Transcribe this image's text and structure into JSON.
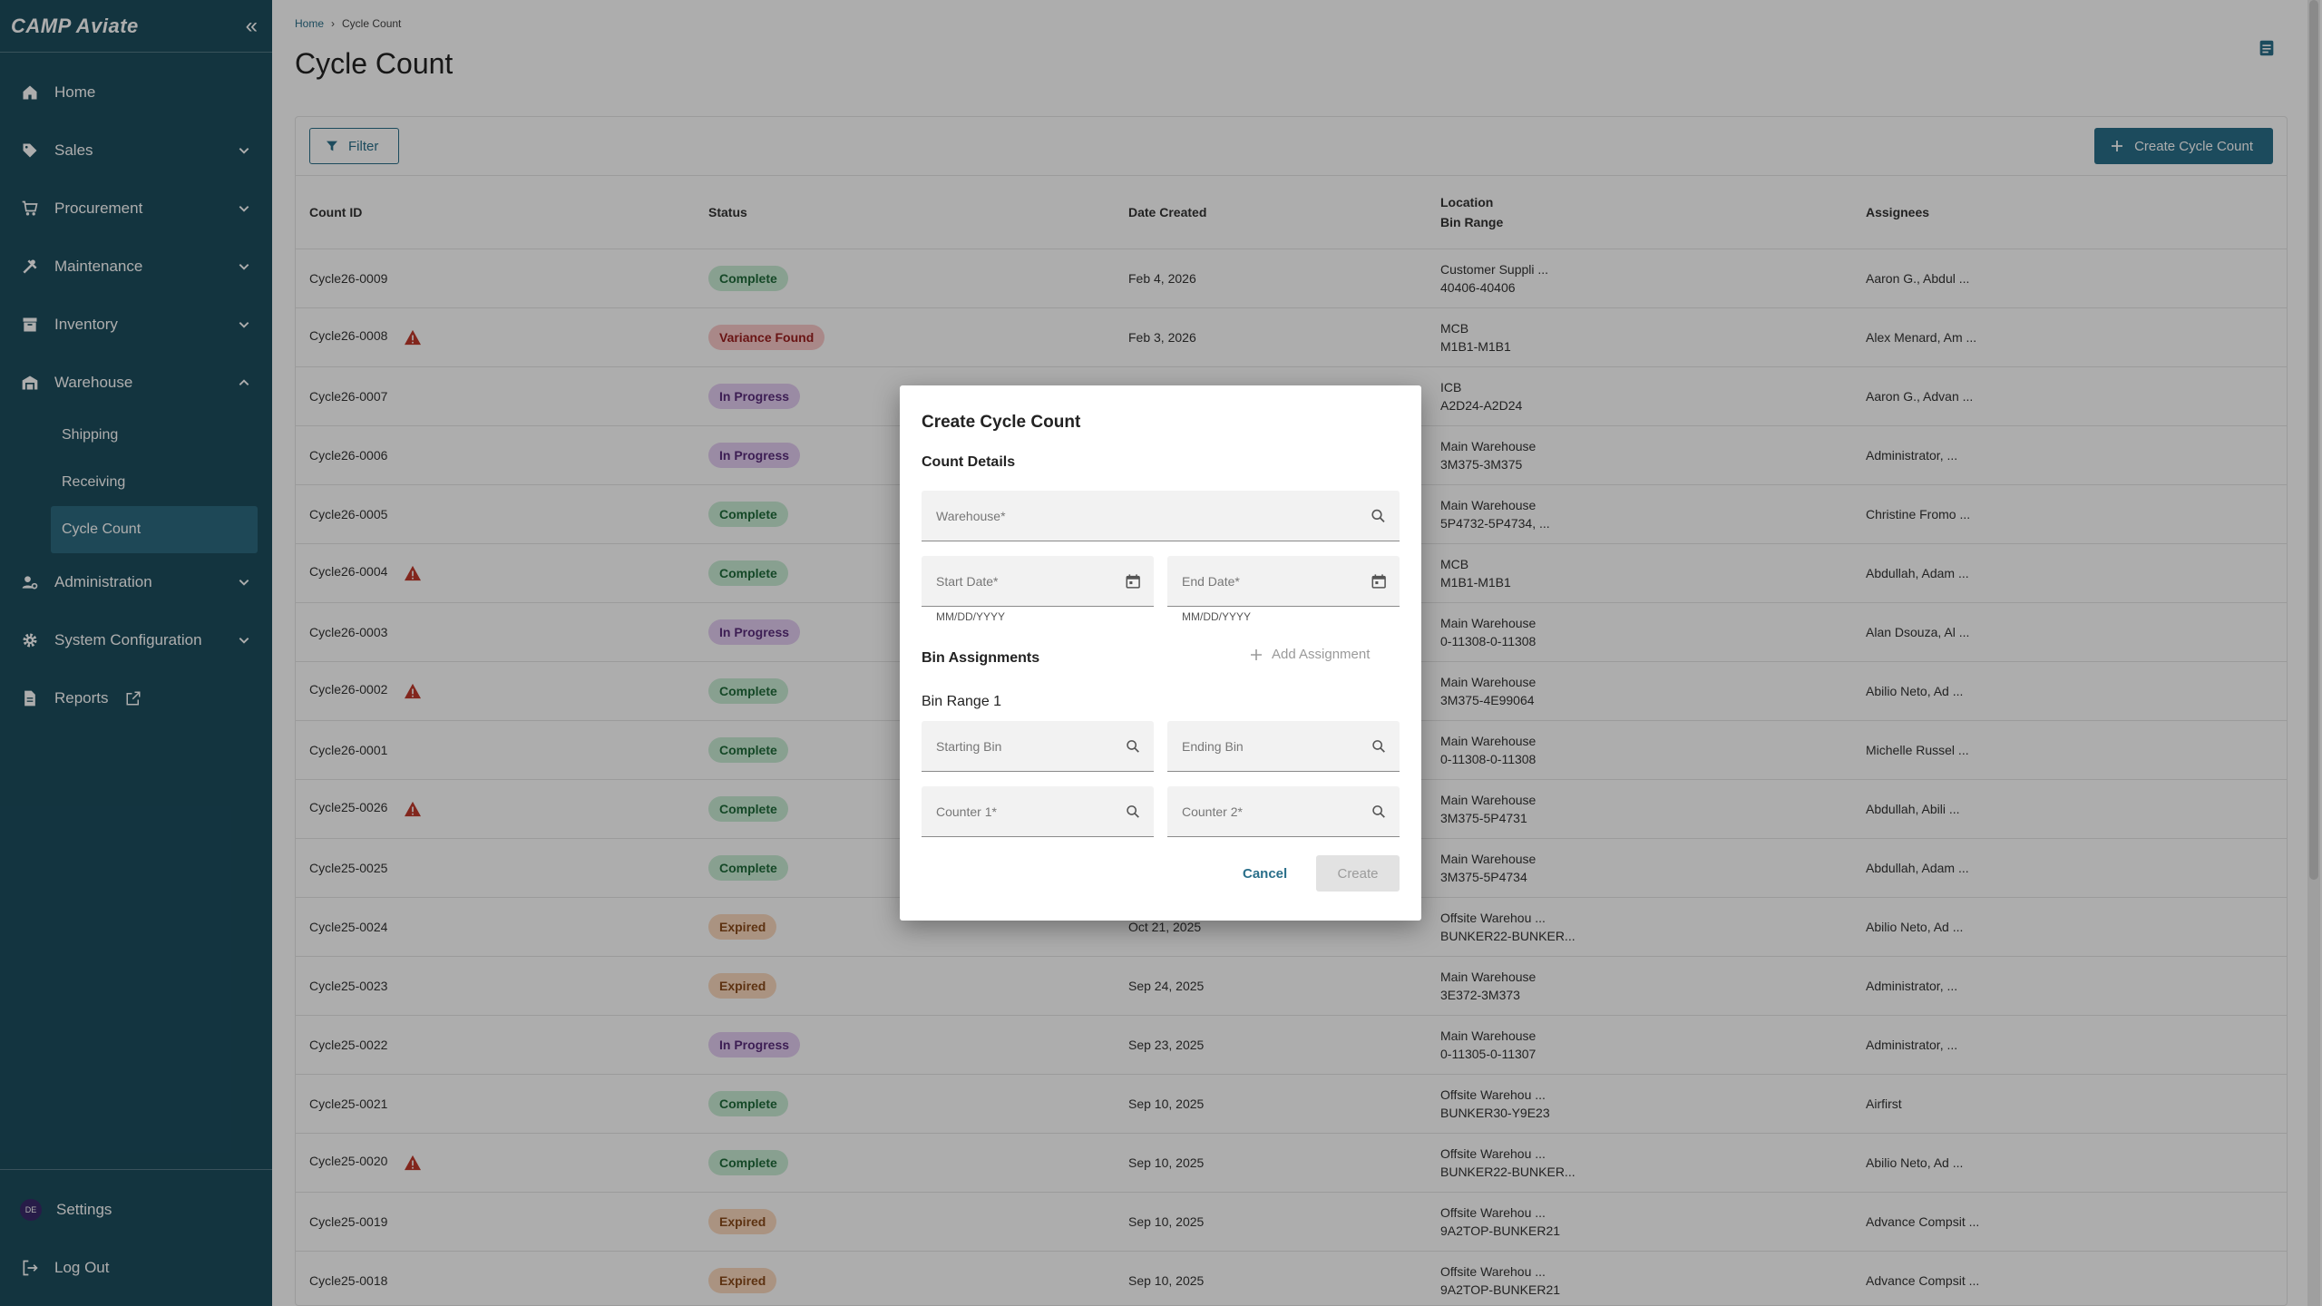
{
  "app": {
    "logo": "CAMP Aviate"
  },
  "sidebar": {
    "items": [
      {
        "label": "Home"
      },
      {
        "label": "Sales"
      },
      {
        "label": "Procurement"
      },
      {
        "label": "Maintenance"
      },
      {
        "label": "Inventory"
      },
      {
        "label": "Warehouse"
      },
      {
        "label": "Administration"
      },
      {
        "label": "System Configuration"
      },
      {
        "label": "Reports"
      }
    ],
    "warehouse_sub": [
      {
        "label": "Shipping"
      },
      {
        "label": "Receiving"
      },
      {
        "label": "Cycle Count"
      }
    ],
    "bottom": {
      "avatar": "DE",
      "settings": "Settings",
      "logout": "Log Out"
    }
  },
  "breadcrumb": {
    "home": "Home",
    "current": "Cycle Count"
  },
  "page": {
    "title": "Cycle Count"
  },
  "toolbar": {
    "filter": "Filter",
    "create": "Create Cycle Count"
  },
  "table": {
    "headers": {
      "count_id": "Count ID",
      "status": "Status",
      "date_created": "Date Created",
      "location": "Location",
      "bin_range": "Bin Range",
      "assignees": "Assignees"
    },
    "rows": [
      {
        "id": "Cycle26-0009",
        "status": "Complete",
        "date": "Feb 4, 2026",
        "location": "Customer Suppli ...",
        "bins": "40406-40406",
        "assignees": "Aaron G., Abdul ..."
      },
      {
        "id": "Cycle26-0008",
        "warn": true,
        "status": "Variance Found",
        "date": "Feb 3, 2026",
        "location": "MCB",
        "bins": "M1B1-M1B1",
        "assignees": "Alex Menard, Am ..."
      },
      {
        "id": "Cycle26-0007",
        "status": "In Progress",
        "date": "",
        "location": "ICB",
        "bins": "A2D24-A2D24",
        "assignees": "Aaron G., Advan ..."
      },
      {
        "id": "Cycle26-0006",
        "status": "In Progress",
        "date": "",
        "location": "Main Warehouse",
        "bins": "3M375-3M375",
        "assignees": "Administrator, ..."
      },
      {
        "id": "Cycle26-0005",
        "status": "Complete",
        "date": "",
        "location": "Main Warehouse",
        "bins": "5P4732-5P4734, ...",
        "assignees": "Christine Fromo ..."
      },
      {
        "id": "Cycle26-0004",
        "warn": true,
        "status": "Complete",
        "date": "",
        "location": "MCB",
        "bins": "M1B1-M1B1",
        "assignees": "Abdullah, Adam ..."
      },
      {
        "id": "Cycle26-0003",
        "status": "In Progress",
        "date": "",
        "location": "Main Warehouse",
        "bins": "0-11308-0-11308",
        "assignees": "Alan Dsouza, Al ..."
      },
      {
        "id": "Cycle26-0002",
        "warn": true,
        "status": "Complete",
        "date": "",
        "location": "Main Warehouse",
        "bins": "3M375-4E99064",
        "assignees": "Abilio Neto, Ad ..."
      },
      {
        "id": "Cycle26-0001",
        "status": "Complete",
        "date": "",
        "location": "Main Warehouse",
        "bins": "0-11308-0-11308",
        "assignees": "Michelle Russel ..."
      },
      {
        "id": "Cycle25-0026",
        "warn": true,
        "status": "Complete",
        "date": "",
        "location": "Main Warehouse",
        "bins": "3M375-5P4731",
        "assignees": "Abdullah, Abili ..."
      },
      {
        "id": "Cycle25-0025",
        "status": "Complete",
        "date": "",
        "location": "Main Warehouse",
        "bins": "3M375-5P4734",
        "assignees": "Abdullah, Adam ..."
      },
      {
        "id": "Cycle25-0024",
        "status": "Expired",
        "date": "Oct 21, 2025",
        "location": "Offsite Warehou ...",
        "bins": "BUNKER22-BUNKER...",
        "assignees": "Abilio Neto, Ad ..."
      },
      {
        "id": "Cycle25-0023",
        "status": "Expired",
        "date": "Sep 24, 2025",
        "location": "Main Warehouse",
        "bins": "3E372-3M373",
        "assignees": "Administrator, ..."
      },
      {
        "id": "Cycle25-0022",
        "status": "In Progress",
        "date": "Sep 23, 2025",
        "location": "Main Warehouse",
        "bins": "0-11305-0-11307",
        "assignees": "Administrator, ..."
      },
      {
        "id": "Cycle25-0021",
        "status": "Complete",
        "date": "Sep 10, 2025",
        "location": "Offsite Warehou ...",
        "bins": "BUNKER30-Y9E23",
        "assignees": "Airfirst"
      },
      {
        "id": "Cycle25-0020",
        "warn": true,
        "status": "Complete",
        "date": "Sep 10, 2025",
        "location": "Offsite Warehou ...",
        "bins": "BUNKER22-BUNKER...",
        "assignees": "Abilio Neto, Ad ..."
      },
      {
        "id": "Cycle25-0019",
        "status": "Expired",
        "date": "Sep 10, 2025",
        "location": "Offsite Warehou ...",
        "bins": "9A2TOP-BUNKER21",
        "assignees": "Advance Compsit ..."
      },
      {
        "id": "Cycle25-0018",
        "status": "Expired",
        "date": "Sep 10, 2025",
        "location": "Offsite Warehou ...",
        "bins": "9A2TOP-BUNKER21",
        "assignees": "Advance Compsit ..."
      }
    ]
  },
  "status_colors": {
    "Complete": {
      "bg": "#c9ecd5",
      "fg": "#1f6b3a"
    },
    "Variance Found": {
      "bg": "#f9c9c9",
      "fg": "#9b1c1c"
    },
    "In Progress": {
      "bg": "#e3cdf2",
      "fg": "#5b2d7d"
    },
    "Expired": {
      "bg": "#fbd9bf",
      "fg": "#8a4a1a"
    }
  },
  "modal": {
    "title": "Create Cycle Count",
    "count_details": "Count Details",
    "warehouse_placeholder": "Warehouse*",
    "start_date_placeholder": "Start Date*",
    "end_date_placeholder": "End Date*",
    "date_hint": "MM/DD/YYYY",
    "bin_assignments": "Bin Assignments",
    "add_assignment": "Add Assignment",
    "bin_range_label": "Bin Range 1",
    "starting_bin_placeholder": "Starting Bin",
    "ending_bin_placeholder": "Ending Bin",
    "counter1_placeholder": "Counter 1*",
    "counter2_placeholder": "Counter 2*",
    "cancel": "Cancel",
    "create": "Create"
  }
}
